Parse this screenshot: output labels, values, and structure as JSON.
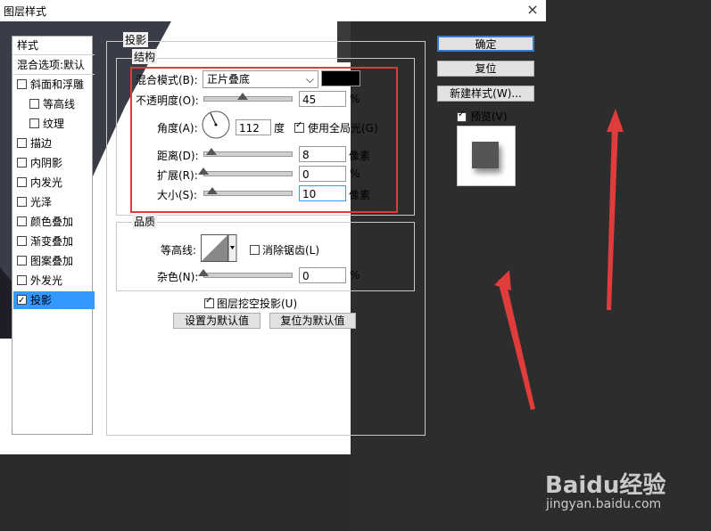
{
  "dialog": {
    "title": "图层样式",
    "close": "×"
  },
  "left_panel": {
    "items": [
      {
        "label": "样式",
        "checkbox": false
      },
      {
        "label": "混合选项:默认",
        "checkbox": false
      },
      {
        "label": "斜面和浮雕",
        "checkbox": true,
        "checked": false
      },
      {
        "label": "等高线",
        "checkbox": true,
        "checked": false
      },
      {
        "label": "纹理",
        "checkbox": true,
        "checked": false
      },
      {
        "label": "描边",
        "checkbox": true,
        "checked": false
      },
      {
        "label": "内阴影",
        "checkbox": true,
        "checked": false
      },
      {
        "label": "内发光",
        "checkbox": true,
        "checked": false
      },
      {
        "label": "光泽",
        "checkbox": true,
        "checked": false
      },
      {
        "label": "颜色叠加",
        "checkbox": true,
        "checked": false
      },
      {
        "label": "渐变叠加",
        "checkbox": true,
        "checked": false
      },
      {
        "label": "图案叠加",
        "checkbox": true,
        "checked": false
      },
      {
        "label": "外发光",
        "checkbox": true,
        "checked": false
      },
      {
        "label": "投影",
        "checkbox": true,
        "checked": true
      }
    ]
  },
  "shadow": {
    "section_title": "投影",
    "structure_title": "结构",
    "blend_label": "混合模式(B):",
    "blend_value": "正片叠底",
    "blend_color": "#000000",
    "opacity_label": "不透明度(O):",
    "opacity_value": "45",
    "percent": "%",
    "angle_label": "角度(A):",
    "angle_value": "112",
    "degree": "度",
    "global_light_label": "使用全局光(G)",
    "distance_label": "距离(D):",
    "distance_value": "8",
    "pixels": "像素",
    "spread_label": "扩展(R):",
    "spread_value": "0",
    "size_label": "大小(S):",
    "size_value": "10",
    "quality_title": "品质",
    "contour_label": "等高线:",
    "antialias_label": "消除锯齿(L)",
    "noise_label": "杂色(N):",
    "noise_value": "0",
    "knockout_label": "图层挖空投影(U)",
    "set_default": "设置为默认值",
    "reset_default": "复位为默认值"
  },
  "right_buttons": {
    "ok": "确定",
    "reset": "复位",
    "new_style": "新建样式(W)...",
    "preview_label": "预览(V)"
  },
  "watermark": {
    "brand": "Baidu经验",
    "url": "jingyan.baidu.com"
  },
  "annotation_color": "#e03c3c"
}
